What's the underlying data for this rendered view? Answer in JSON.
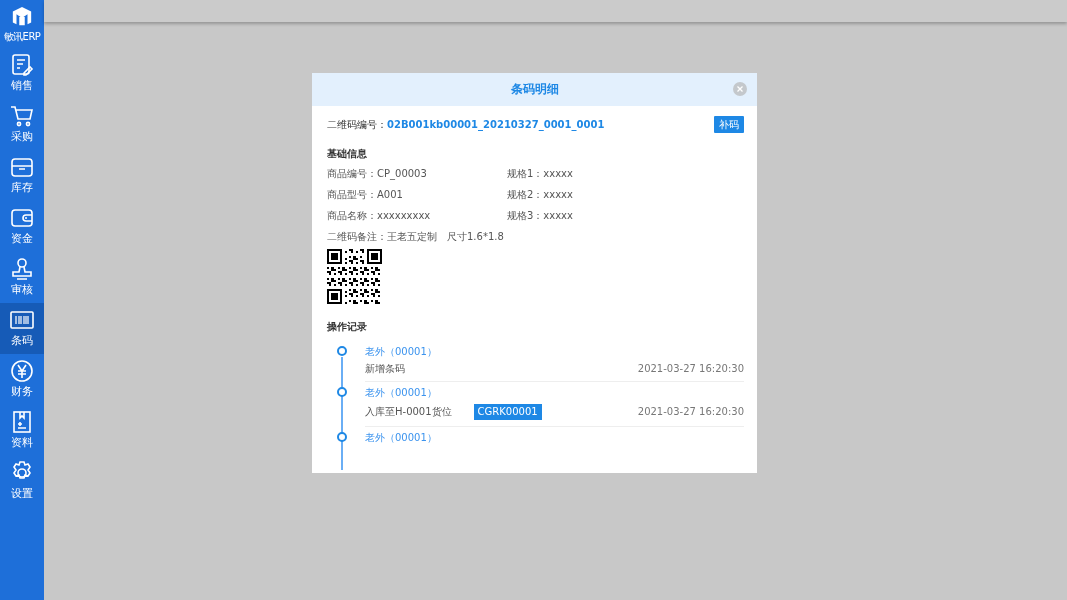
{
  "sidebar": {
    "logo_label": "敏讯ERP",
    "items": [
      {
        "label": "销售",
        "selected": false
      },
      {
        "label": "采购",
        "selected": false
      },
      {
        "label": "库存",
        "selected": false
      },
      {
        "label": "资金",
        "selected": false
      },
      {
        "label": "审核",
        "selected": false
      },
      {
        "label": "条码",
        "selected": true
      },
      {
        "label": "财务",
        "selected": false
      },
      {
        "label": "资料",
        "selected": false
      },
      {
        "label": "设置",
        "selected": false
      }
    ]
  },
  "dialog": {
    "title": "条码明细",
    "code_label": "二维码编号：",
    "code_value": "02B001kb00001_20210327_0001_0001",
    "reprint_button": "补码",
    "basic_title": "基础信息",
    "fields": [
      {
        "label": "商品编号：",
        "value": "CP_00003"
      },
      {
        "label": "规格1：",
        "value": "xxxxx"
      },
      {
        "label": "商品型号：",
        "value": "A001"
      },
      {
        "label": "规格2：",
        "value": "xxxxx"
      },
      {
        "label": "商品名称：",
        "value": "xxxxxxxxx"
      },
      {
        "label": "规格3：",
        "value": "xxxxx"
      }
    ],
    "note_label": "二维码备注：",
    "note_value": "王老五定制　尺寸1.6*1.8",
    "log_title": "操作记录",
    "log": [
      {
        "user": "老外（00001）",
        "action": "新增条码",
        "time": "2021-03-27 16:20:30"
      },
      {
        "user": "老外（00001）",
        "action": "入库至H-0001货位",
        "tag": "CGRK00001",
        "time": "2021-03-27 16:20:30"
      },
      {
        "user": "老外（00001）"
      }
    ]
  }
}
